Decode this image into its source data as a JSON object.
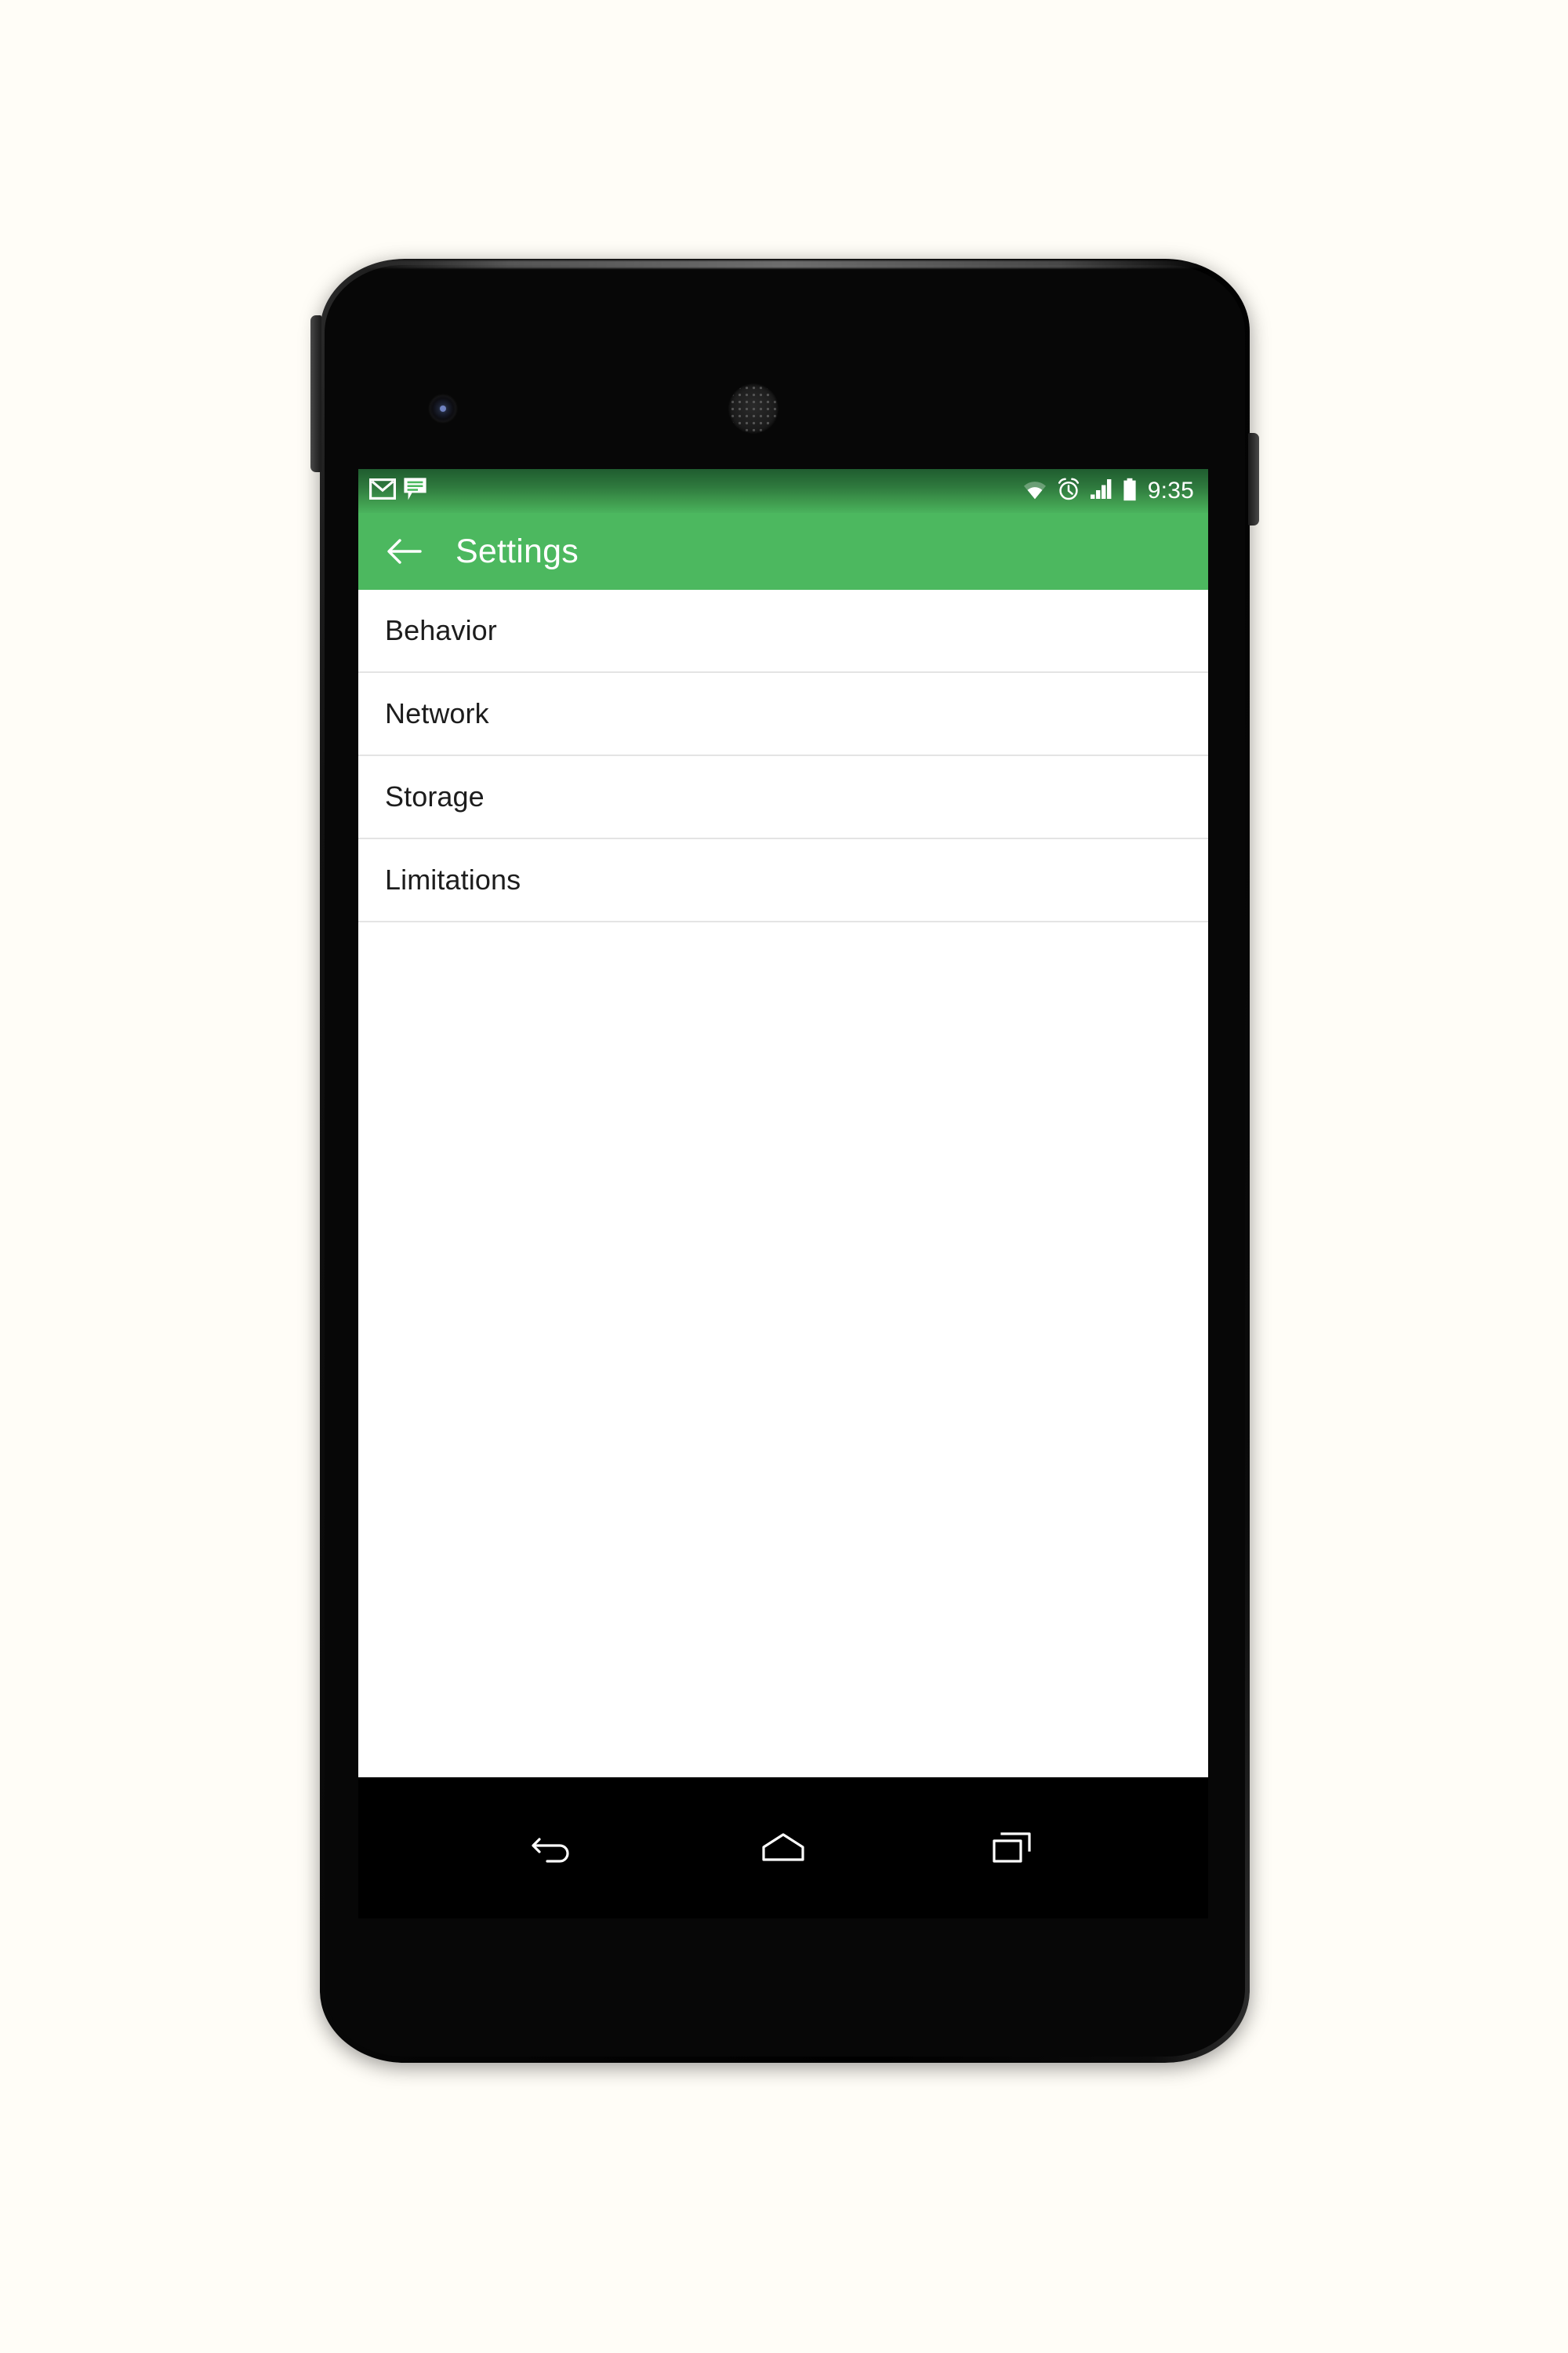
{
  "device": {
    "name": "android-phone-mockup",
    "components": {
      "front_camera": "front-camera",
      "earpiece": "earpiece-speaker",
      "volume_button": "volume-rocker",
      "power_button": "power-button"
    }
  },
  "colors": {
    "page_background": "#FFFDF7",
    "toolbar_green": "#4CB85F",
    "status_bar_dark": "#1F5C2F",
    "screen_background": "#FFFFFF",
    "divider": "#E4E4E4",
    "list_text": "#1D1D1D",
    "toolbar_text": "#FFFFFF",
    "nav_bar": "#000000",
    "device_body": "#050505"
  },
  "status_bar": {
    "time": "9:35",
    "left_icons": [
      {
        "name": "gmail-icon",
        "label": "Gmail notification"
      },
      {
        "name": "message-icon",
        "label": "Message notification"
      }
    ],
    "right_icons": [
      {
        "name": "wifi-icon",
        "label": "Wi-Fi connected"
      },
      {
        "name": "alarm-icon",
        "label": "Alarm set"
      },
      {
        "name": "signal-icon",
        "label": "Cellular signal"
      },
      {
        "name": "battery-icon",
        "label": "Battery full"
      }
    ]
  },
  "toolbar": {
    "title": "Settings",
    "back_icon": "back-arrow-icon"
  },
  "settings_list": {
    "items": [
      {
        "label": "Behavior"
      },
      {
        "label": "Network"
      },
      {
        "label": "Storage"
      },
      {
        "label": "Limitations"
      }
    ]
  },
  "nav_bar": {
    "buttons": [
      {
        "name": "nav-back-button",
        "label": "Back"
      },
      {
        "name": "nav-home-button",
        "label": "Home"
      },
      {
        "name": "nav-recents-button",
        "label": "Recent apps"
      }
    ]
  }
}
